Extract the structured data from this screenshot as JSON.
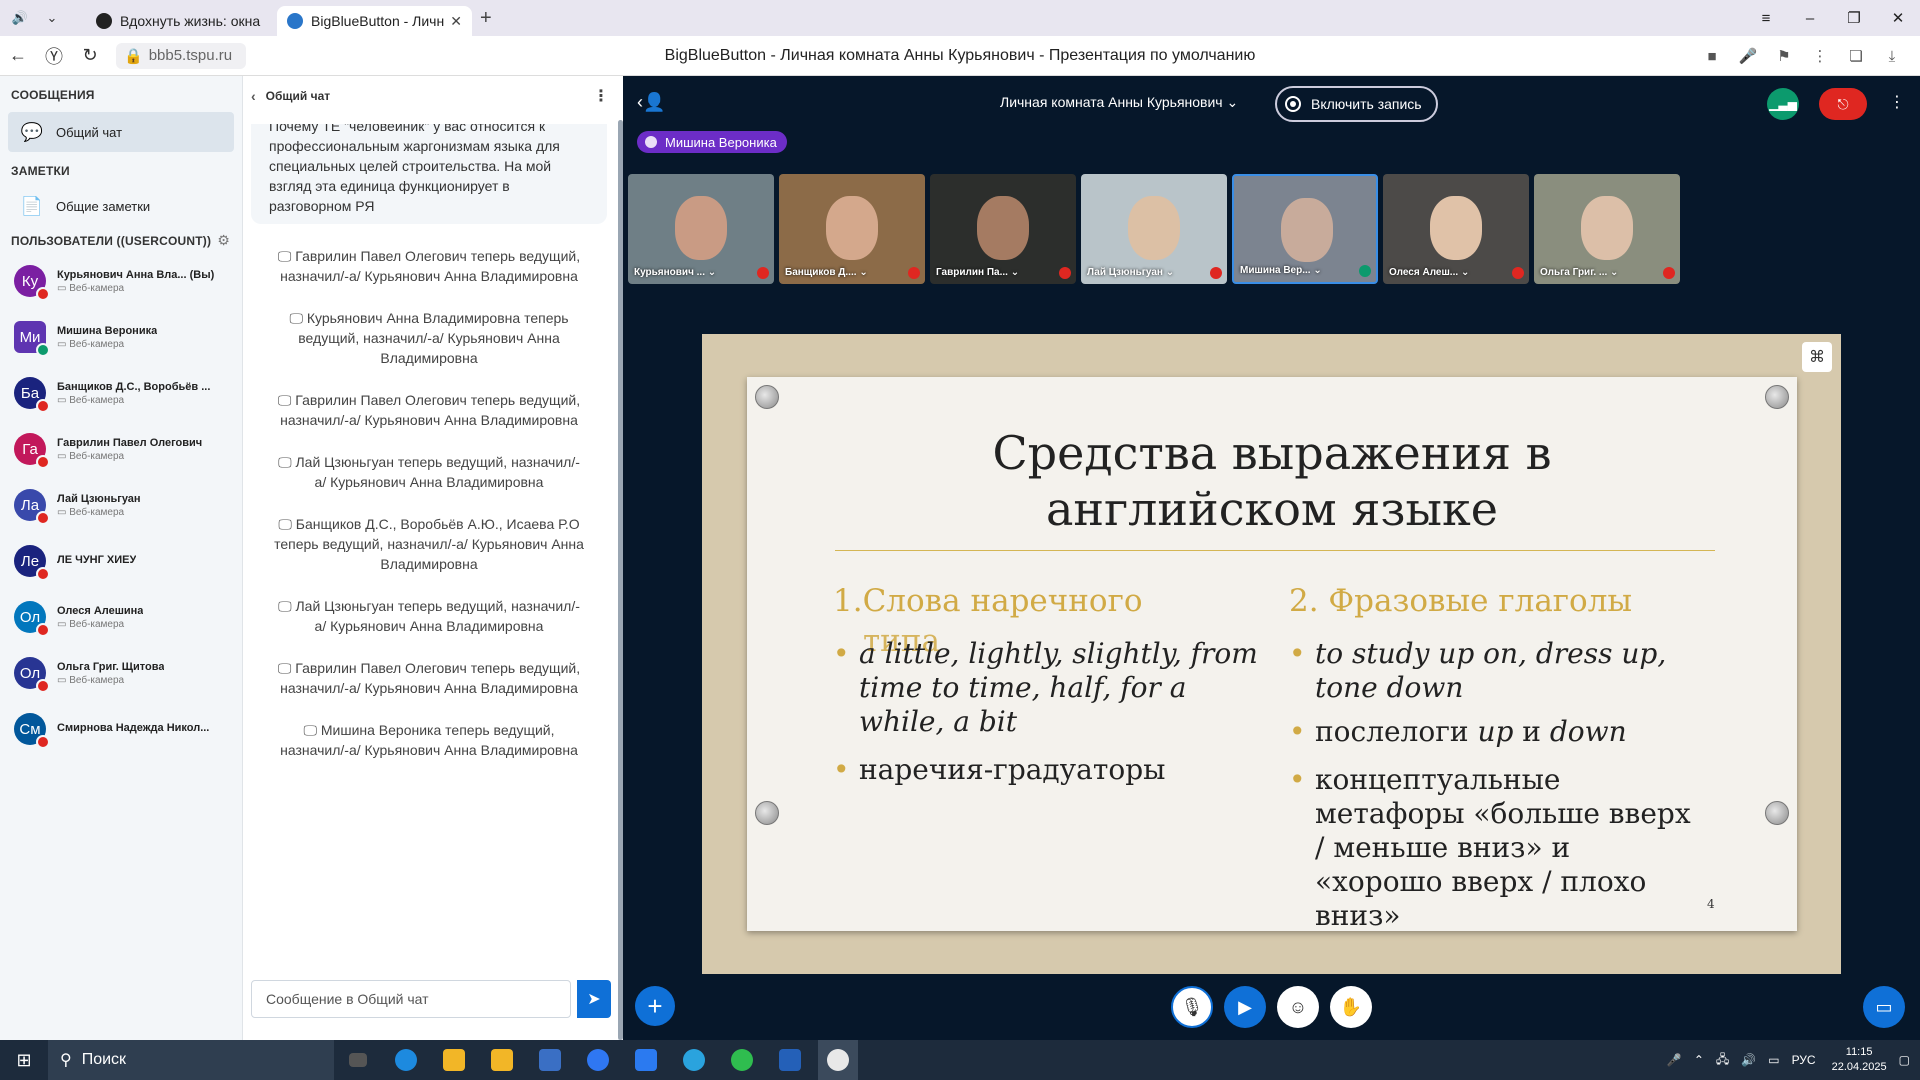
{
  "browser": {
    "tabs": [
      {
        "title": "Вдохнуть жизнь: окна зап"
      },
      {
        "title": "BigBlueButton - Лична"
      }
    ],
    "url": "bbb5.tspu.ru",
    "page_title": "BigBlueButton - Личная комната Анны Курьянович - Презентация по умолчанию"
  },
  "sidebar": {
    "messages_head": "СООБЩЕНИЯ",
    "public_chat": "Общий чат",
    "notes_head": "ЗАМЕТКИ",
    "shared_notes": "Общие заметки",
    "users_head": "ПОЛЬЗОВАТЕЛИ ((USERCOUNT))",
    "users": [
      {
        "initials": "Ку",
        "name": "Курьянович Анна Вла... (Вы)",
        "sub": "▭ Веб-камера",
        "color": "#7b1fa2",
        "presenter": false
      },
      {
        "initials": "Ми",
        "name": "Мишина Вероника",
        "sub": "▭ Веб-камера",
        "color": "#5e35b1",
        "presenter": true
      },
      {
        "initials": "Ба",
        "name": "Банщиков Д.С., Воробьёв ...",
        "sub": "▭ Веб-камера",
        "color": "#1a237e",
        "presenter": false
      },
      {
        "initials": "Га",
        "name": "Гаврилин Павел Олегович",
        "sub": "▭ Веб-камера",
        "color": "#c2185b",
        "presenter": false
      },
      {
        "initials": "Ла",
        "name": "Лай Цзюньгуан",
        "sub": "▭ Веб-камера",
        "color": "#3949ab",
        "presenter": false
      },
      {
        "initials": "Ле",
        "name": "ЛЕ ЧУНГ ХИЕУ",
        "sub": "",
        "color": "#1a237e",
        "presenter": false
      },
      {
        "initials": "Ол",
        "name": "Олеся Алешина",
        "sub": "▭ Веб-камера",
        "color": "#0277bd",
        "presenter": false
      },
      {
        "initials": "Ол",
        "name": "Ольга Григ. Щитова",
        "sub": "▭ Веб-камера",
        "color": "#283593",
        "presenter": false
      },
      {
        "initials": "См",
        "name": "Смирнова Надежда Никол...",
        "sub": "",
        "color": "#01579b",
        "presenter": false
      }
    ]
  },
  "chat": {
    "title": "Общий чат",
    "partial_message": "Почему ТЕ \"человейник\" у вас относится к профессиональным жаргонизмам языка для специальных целей строительства. На мой взгляд эта единица функционирует в разговорном РЯ",
    "system_messages": [
      "Гаврилин Павел Олегович теперь ведущий, назначил/-а/ Курьянович Анна Владимировна",
      "Курьянович Анна Владимировна теперь ведущий, назначил/-а/ Курьянович Анна Владимировна",
      "Гаврилин Павел Олегович теперь ведущий, назначил/-а/ Курьянович Анна Владимировна",
      "Лай Цзюньгуан теперь ведущий, назначил/-а/ Курьянович Анна Владимировна",
      "Банщиков Д.С., Воробьёв А.Ю., Исаева Р.О теперь ведущий, назначил/-а/ Курьянович Анна Владимировна",
      "Лай Цзюньгуан теперь ведущий, назначил/-а/ Курьянович Анна Владимировна",
      "Гаврилин Павел Олегович теперь ведущий, назначил/-а/ Курьянович Анна Владимировна",
      "Мишина Вероника теперь ведущий, назначил/-а/ Курьянович Анна Владимировна"
    ],
    "input_placeholder": "Сообщение в Общий чат"
  },
  "meeting": {
    "room_title": "Личная комната Анны Курьянович",
    "record_label": "Включить запись",
    "talking": "Мишина Вероника",
    "video_tiles": [
      {
        "name": "Курьянович ...",
        "bg": "#6f7f86",
        "face": "#c99b84",
        "highlight": false,
        "mic": "muted"
      },
      {
        "name": "Банщиков Д....",
        "bg": "#8c6b48",
        "face": "#d4a88c",
        "highlight": false,
        "mic": "muted"
      },
      {
        "name": "Гаврилин Па...",
        "bg": "#2c2e2c",
        "face": "#a57b62",
        "highlight": false,
        "mic": "muted"
      },
      {
        "name": "Лай Цзюньгуан",
        "bg": "#b9c4c9",
        "face": "#dcc0a5",
        "highlight": false,
        "mic": "muted"
      },
      {
        "name": "Мишина Вер...",
        "bg": "#7c8490",
        "face": "#c8ab9b",
        "highlight": true,
        "mic": "talking"
      },
      {
        "name": "Олеся Алеш...",
        "bg": "#4c4a48",
        "face": "#e0c2a8",
        "highlight": false,
        "mic": "muted"
      },
      {
        "name": "Ольга Григ. ...",
        "bg": "#8a8e7e",
        "face": "#dcbfa8",
        "highlight": false,
        "mic": "muted"
      }
    ],
    "slide": {
      "title_line1": "Средства выражения в",
      "title_line2": "английском языке",
      "col1_head": "1.Слова наречного",
      "col1_head_overflow": "типа",
      "col1_b1": "a little, lightly, slightly, from time to time, half, for a while, a bit",
      "col1_b2": "наречия-градуаторы",
      "col2_head": "2. Фразовые глаголы",
      "col2_b1": "to study up on, dress up, tone down",
      "col2_b2_pre": "послелоги ",
      "col2_b2_em1": "up",
      "col2_b2_mid": " и ",
      "col2_b2_em2": "down",
      "col2_b3": "концептуальные метафоры «больше вверх / меньше вниз» и «хорошо вверх / плохо вниз»",
      "page_number": "4"
    }
  },
  "taskbar": {
    "search": "Поиск",
    "lang": "РУС",
    "time": "11:15",
    "date": "22.04.2025"
  },
  "colors": {
    "accent": "#0f70d7",
    "danger": "#df2721",
    "success": "#0c9a6d",
    "slide_gold": "#d1aa45"
  }
}
